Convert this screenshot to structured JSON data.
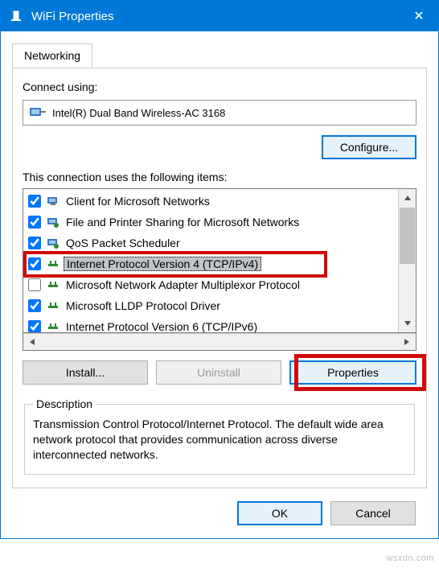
{
  "titlebar": {
    "title": "WiFi Properties",
    "close_glyph": "✕"
  },
  "tab": {
    "networking": "Networking"
  },
  "connect_using_label": "Connect using:",
  "adapter_name": "Intel(R) Dual Band Wireless-AC 3168",
  "configure_label": "Configure...",
  "items_label": "This connection uses the following items:",
  "items": [
    {
      "checked": true,
      "icon": "client",
      "text": "Client for Microsoft Networks"
    },
    {
      "checked": true,
      "icon": "share",
      "text": "File and Printer Sharing for Microsoft Networks"
    },
    {
      "checked": true,
      "icon": "qos",
      "text": "QoS Packet Scheduler"
    },
    {
      "checked": true,
      "icon": "proto",
      "text": "Internet Protocol Version 4 (TCP/IPv4)",
      "selected": true
    },
    {
      "checked": false,
      "icon": "proto",
      "text": "Microsoft Network Adapter Multiplexor Protocol"
    },
    {
      "checked": true,
      "icon": "proto",
      "text": "Microsoft LLDP Protocol Driver"
    },
    {
      "checked": true,
      "icon": "proto",
      "text": "Internet Protocol Version 6 (TCP/IPv6)"
    }
  ],
  "buttons": {
    "install": "Install...",
    "uninstall": "Uninstall",
    "properties": "Properties",
    "ok": "OK",
    "cancel": "Cancel"
  },
  "description": {
    "legend": "Description",
    "text": "Transmission Control Protocol/Internet Protocol. The default wide area network protocol that provides communication across diverse interconnected networks."
  },
  "watermark": "wsxdn.com"
}
